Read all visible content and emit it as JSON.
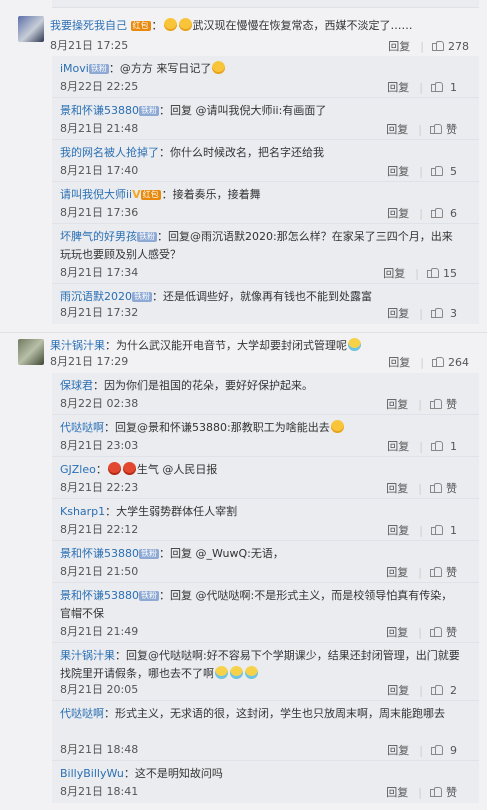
{
  "thread1": {
    "cut_height": 7,
    "top": {
      "user": "我要操死我自己",
      "badge": "红包",
      "text": "武汉现在慢慢在恢复常态，西媒不淡定了……",
      "date": "8月21日 17:25",
      "reply": "回复",
      "likes": "278"
    },
    "replies": [
      {
        "user": "iMovi",
        "vip": "铁粉",
        "text": "@方方 来写日记了",
        "date": "8月22日 22:25",
        "reply": "回复",
        "likes": "1"
      },
      {
        "user": "景和怀谦53880",
        "vip": "铁粉",
        "text": "回复 @请叫我倪大师ii:有画面了",
        "date": "8月21日 21:48",
        "reply": "回复",
        "likes": "赞"
      },
      {
        "user": "我的网名被人抢掉了",
        "text": "你什么时候改名，把名字还给我",
        "date": "8月21日 17:40",
        "reply": "回复",
        "likes": "5"
      },
      {
        "user": "请叫我倪大师ii",
        "badge": "红包",
        "text": "接着奏乐，接着舞",
        "date": "8月21日 17:36",
        "reply": "回复",
        "likes": "6"
      },
      {
        "user": "坏脾气的好男孩",
        "vip": "铁粉",
        "text": "回复@雨沉语默2020:那怎么样？在家呆了三四个月，出来玩玩也要顾及别人感受？",
        "date": "8月21日 17:34",
        "reply": "回复",
        "likes": "15"
      },
      {
        "user": "雨沉语默2020",
        "vip": "铁粉",
        "text": "还是低调些好，就像再有钱也不能到处露富",
        "date": "8月21日 17:32",
        "reply": "回复",
        "likes": "3"
      }
    ]
  },
  "thread2": {
    "top": {
      "user": "果汁锅汁果",
      "text": "为什么武汉能开电音节，大学却要封闭式管理呢",
      "date": "8月21日 17:29",
      "reply": "回复",
      "likes": "264"
    },
    "replies": [
      {
        "user": "保球君",
        "text": "因为你们是祖国的花朵，要好好保护起来。",
        "date": "8月22日 02:38",
        "reply": "回复",
        "likes": "赞"
      },
      {
        "user": "代哒哒啊",
        "text": "回复@景和怀谦53880:那教职工为啥能出去",
        "date": "8月21日 23:03",
        "reply": "回复",
        "likes": "1"
      },
      {
        "user": "GJZleo",
        "text": "生气 @人民日报",
        "date": "8月21日 22:23",
        "reply": "回复",
        "likes": "赞"
      },
      {
        "user": "Ksharp1",
        "text": "大学生弱势群体任人宰割",
        "date": "8月21日 22:12",
        "reply": "回复",
        "likes": "1"
      },
      {
        "user": "景和怀谦53880",
        "vip": "铁粉",
        "text": "回复 @_WuwQ:无语，",
        "date": "8月21日 21:50",
        "reply": "回复",
        "likes": "赞"
      },
      {
        "user": "景和怀谦53880",
        "vip": "铁粉",
        "text": "回复 @代哒哒啊:不是形式主义，而是校领导怕真有传染，官帽不保",
        "date": "8月21日 21:49",
        "reply": "回复",
        "likes": "赞"
      },
      {
        "user": "果汁锅汁果",
        "text": "回复@代哒哒啊:好不容易下个学期课少，结果还封闭管理，出门就要找院里开请假条，哪也去不了啊",
        "date": "8月21日 20:05",
        "reply": "回复",
        "likes": "2"
      },
      {
        "user": "代哒哒啊",
        "text": "形式主义，无求语的很，这封闭，学生也只放周末啊，周末能跑哪去",
        "date": "8月21日 18:48",
        "reply": "回复",
        "likes": "9"
      },
      {
        "user": "BillyBillyWu",
        "text": "这不是明知故问吗",
        "date": "8月21日 18:41",
        "reply": "回复",
        "likes": "赞"
      }
    ]
  }
}
